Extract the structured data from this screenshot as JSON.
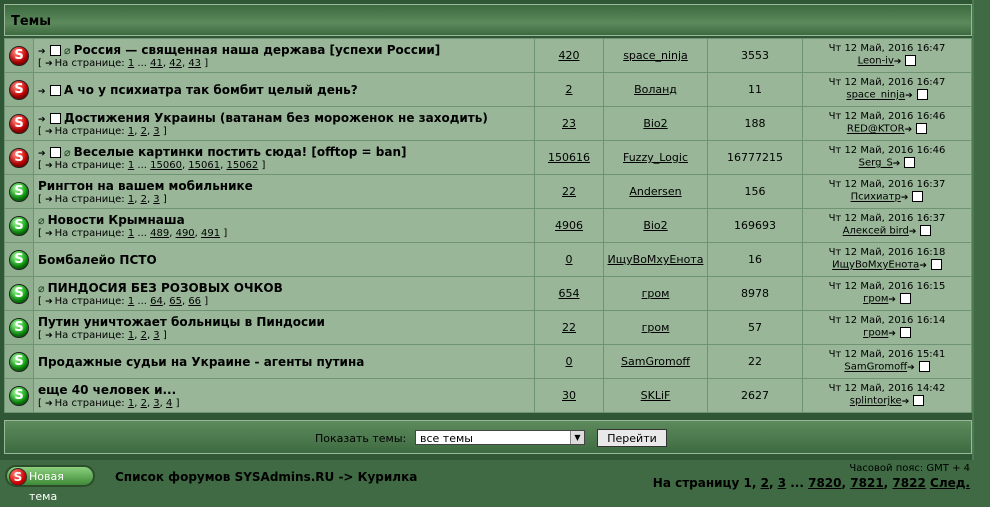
{
  "header": {
    "title": "Темы"
  },
  "labels": {
    "on_page": "На странице:",
    "ellipsis": "..."
  },
  "topics": [
    {
      "status": "hot",
      "clip": true,
      "arrow": true,
      "title": "Россия — священная наша держава [успехи России]",
      "pages": [
        "1",
        "...",
        "41",
        "42",
        "43"
      ],
      "replies": "420",
      "author": "space_ninja",
      "views": "3553",
      "last_date": "Чт 12 Май, 2016 16:47",
      "last_user": "Leon-iv"
    },
    {
      "status": "hot",
      "clip": false,
      "arrow": true,
      "title": "А чо у психиатра так бомбит целый день?",
      "pages": [],
      "replies": "2",
      "author": "Воланд",
      "views": "11",
      "last_date": "Чт 12 Май, 2016 16:47",
      "last_user": "space_ninja"
    },
    {
      "status": "hot",
      "clip": false,
      "arrow": true,
      "title": "Достижения Украины (ватанам без мороженок не заходить)",
      "pages": [
        "1",
        "2",
        "3"
      ],
      "replies": "23",
      "author": "Bio2",
      "views": "188",
      "last_date": "Чт 12 Май, 2016 16:46",
      "last_user": "RED@KTOR"
    },
    {
      "status": "hot",
      "clip": true,
      "arrow": true,
      "title": "Веселые картинки постить сюда! [offtop = ban]",
      "pages": [
        "1",
        "...",
        "15060",
        "15061",
        "15062"
      ],
      "replies": "150616",
      "author": "Fuzzy_Logic",
      "views": "16777215",
      "last_date": "Чт 12 Май, 2016 16:46",
      "last_user": "Serg_S"
    },
    {
      "status": "ok",
      "clip": false,
      "arrow": false,
      "title": "Рингтон на вашем мобильнике",
      "pages": [
        "1",
        "2",
        "3"
      ],
      "replies": "22",
      "author": "Andersen",
      "views": "156",
      "last_date": "Чт 12 Май, 2016 16:37",
      "last_user": "Психиатр"
    },
    {
      "status": "ok",
      "clip": true,
      "arrow": false,
      "title": "Новости Крымнаша",
      "pages": [
        "1",
        "...",
        "489",
        "490",
        "491"
      ],
      "replies": "4906",
      "author": "Bio2",
      "views": "169693",
      "last_date": "Чт 12 Май, 2016 16:37",
      "last_user": "Алексей bird"
    },
    {
      "status": "ok",
      "clip": false,
      "arrow": false,
      "title": "Бомбалейо ПСТО",
      "pages": [],
      "replies": "0",
      "author": "ИщуВоМхуЕнота",
      "views": "16",
      "last_date": "Чт 12 Май, 2016 16:18",
      "last_user": "ИщуВоМхуЕнота"
    },
    {
      "status": "ok",
      "clip": true,
      "arrow": false,
      "title": "ПИНДОСИЯ БЕЗ РОЗОВЫХ ОЧКОВ",
      "pages": [
        "1",
        "...",
        "64",
        "65",
        "66"
      ],
      "replies": "654",
      "author": "гром",
      "views": "8978",
      "last_date": "Чт 12 Май, 2016 16:15",
      "last_user": "гром"
    },
    {
      "status": "ok",
      "clip": false,
      "arrow": false,
      "title": "Путин уничтожает больницы в Пиндосии",
      "pages": [
        "1",
        "2",
        "3"
      ],
      "replies": "22",
      "author": "гром",
      "views": "57",
      "last_date": "Чт 12 Май, 2016 16:14",
      "last_user": "гром"
    },
    {
      "status": "ok",
      "clip": false,
      "arrow": false,
      "title": "Продажные судьи на Украине - агенты путина",
      "pages": [],
      "replies": "0",
      "author": "SamGromoff",
      "views": "22",
      "last_date": "Чт 12 Май, 2016 15:41",
      "last_user": "SamGromoff"
    },
    {
      "status": "ok",
      "clip": false,
      "arrow": false,
      "title": "еще 40 человек и...",
      "pages": [
        "1",
        "2",
        "3",
        "4"
      ],
      "replies": "30",
      "author": "SKLiF",
      "views": "2627",
      "last_date": "Чт 12 Май, 2016 14:42",
      "last_user": "splintorjke"
    }
  ],
  "filter": {
    "label": "Показать темы:",
    "selected": "все темы",
    "button": "Перейти"
  },
  "footer": {
    "new_topic": "Новая тема",
    "breadcrumb": "Список форумов SYSAdmins.RU -> Курилка",
    "timezone": "Часовой пояс: GMT + 4",
    "pagination_prefix": "На страницу",
    "pages": [
      "1",
      "2",
      "3",
      "...",
      "7820",
      "7821",
      "7822"
    ],
    "next": "След."
  },
  "colors": {
    "hot": "#d00000",
    "ok": "#12a712",
    "row_bg": "#99b699",
    "frame": "#2f5735"
  }
}
